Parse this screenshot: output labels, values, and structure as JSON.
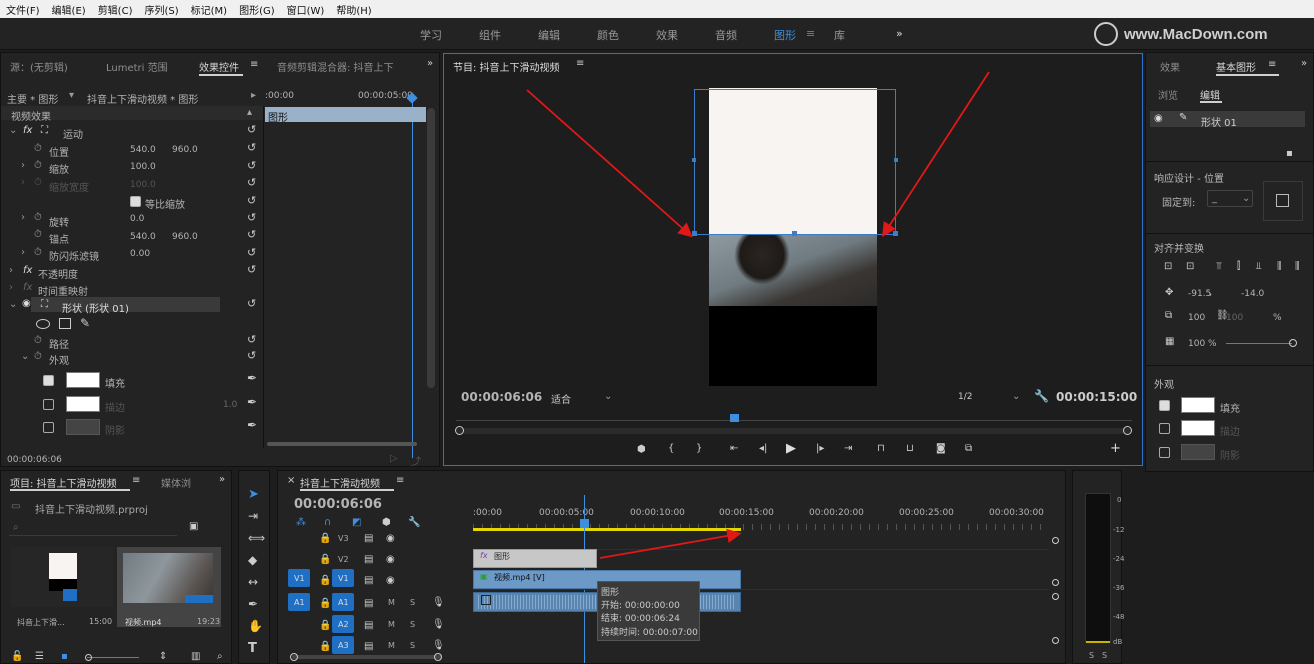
{
  "menu": [
    "文件(F)",
    "编辑(E)",
    "剪辑(C)",
    "序列(S)",
    "标记(M)",
    "图形(G)",
    "窗口(W)",
    "帮助(H)"
  ],
  "workspaces": [
    "学习",
    "组件",
    "编辑",
    "颜色",
    "效果",
    "音频",
    "图形",
    "库"
  ],
  "workspace_active": "图形",
  "watermark": "www.MacDown.com",
  "left_tabs": {
    "source": "源：(无剪辑)",
    "lumetri": "Lumetri 范围",
    "effect_controls": "效果控件",
    "audio_mixer": "音频剪辑混合器: 抖音上下"
  },
  "ec": {
    "master": "主要 * 图形",
    "clip": "抖音上下滑动视频 * 图形",
    "tc_start": ":00:00",
    "tc_end": "00:00:05:00",
    "clip_label": "图形",
    "video_effects": "视频效果",
    "motion": "运动",
    "position_label": "位置",
    "position_x": "540.0",
    "position_y": "960.0",
    "scale_label": "缩放",
    "scale": "100.0",
    "scale_width_label": "缩放宽度",
    "scale_width": "100.0",
    "uniform_scale": "等比缩放",
    "rotation_label": "旋转",
    "rotation": "0.0",
    "anchor_label": "锚点",
    "anchor_x": "540.0",
    "anchor_y": "960.0",
    "antiflicker_label": "防闪烁滤镜",
    "antiflicker": "0.00",
    "opacity": "不透明度",
    "time_remap": "时间重映射",
    "shape": "形状 (形状 01)",
    "path": "路径",
    "appearance": "外观",
    "fill": "填充",
    "stroke": "描边",
    "stroke_width": "1.0",
    "shadow": "阴影",
    "footer_tc": "00:00:06:06"
  },
  "monitor": {
    "title": "节目: 抖音上下滑动视频",
    "timecode": "00:00:06:06",
    "fit": "适合",
    "resolution": "1/2",
    "duration": "00:00:15:00"
  },
  "right": {
    "tab_effects": "效果",
    "tab_eg": "基本图形",
    "sub_browse": "浏览",
    "sub_edit": "编辑",
    "layer": "形状 01",
    "responsive": "响应设计 - 位置",
    "pin_to": "固定到:",
    "pin_value": "_",
    "align": "对齐并变换",
    "pos_x": "-91.5",
    "pos_y": "-14.0",
    "scale_w": "100",
    "scale_h": "100",
    "pct": "%",
    "opacity": "100 %",
    "appearance": "外观",
    "fill": "填充",
    "stroke": "描边",
    "shadow": "阴影"
  },
  "project": {
    "tab_project": "项目: 抖音上下滑动视频",
    "tab_media": "媒体浏",
    "file": "抖音上下滑动视频.prproj",
    "item1_name": "抖音上下滑...",
    "item1_dur": "15:00",
    "item2_name": "视频.mp4",
    "item2_dur": "19:23"
  },
  "timeline": {
    "title": "抖音上下滑动视频",
    "timecode": "00:00:06:06",
    "ruler": [
      ":00:00",
      "00:00:05:00",
      "00:00:10:00",
      "00:00:15:00",
      "00:00:20:00",
      "00:00:25:00",
      "00:00:30:00"
    ],
    "tracks_v": [
      "V3",
      "V2",
      "V1"
    ],
    "tracks_a": [
      "A1",
      "A2",
      "A3"
    ],
    "src_v": "V1",
    "src_a": "A1",
    "m": "M",
    "s": "S",
    "clip_graphic": "图形",
    "clip_video": "视频.mp4 [V]",
    "tooltip_title": "图形",
    "tooltip_start": "开始: 00:00:00:00",
    "tooltip_end": "结束: 00:00:06:24",
    "tooltip_dur": "持续时间: 00:00:07:00"
  },
  "meter": {
    "scale": [
      "0",
      "-12",
      "-24",
      "-36",
      "-48",
      "dB"
    ],
    "s1": "S",
    "s2": "S"
  }
}
